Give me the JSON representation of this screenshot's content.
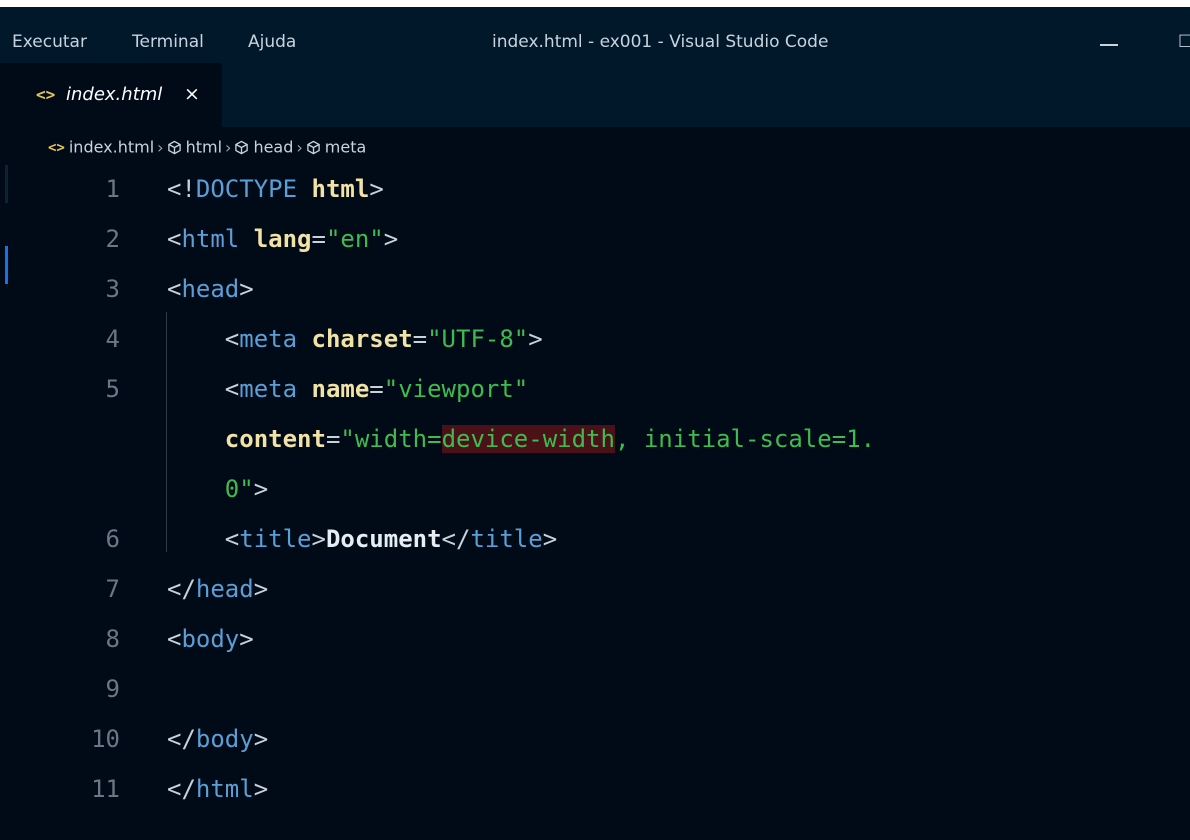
{
  "titlebar": {
    "menu": [
      "Executar",
      "Terminal",
      "Ajuda"
    ],
    "window_title": "index.html - ex001 - Visual Studio Code"
  },
  "tabs": [
    {
      "label": "index.html",
      "close": "×",
      "icon": "html-file-icon"
    }
  ],
  "breadcrumb": [
    "index.html",
    "html",
    "head",
    "meta"
  ],
  "editor": {
    "line_numbers": [
      "1",
      "2",
      "3",
      "4",
      "5",
      "6",
      "7",
      "8",
      "9",
      "10",
      "11"
    ],
    "colors": {
      "tag": "#5a9fd8",
      "attribute": "#f1e2a6",
      "string": "#3fbb4f",
      "punctuation": "#c9d1d9",
      "highlight": "#4a1118"
    },
    "lines": [
      [
        {
          "t": "p",
          "v": "<!"
        },
        {
          "t": "t",
          "v": "DOCTYPE"
        },
        {
          "t": "p",
          "v": " "
        },
        {
          "t": "a",
          "v": "html"
        },
        {
          "t": "p",
          "v": ">"
        }
      ],
      [
        {
          "t": "p",
          "v": "<"
        },
        {
          "t": "t",
          "v": "html"
        },
        {
          "t": "p",
          "v": " "
        },
        {
          "t": "a",
          "v": "lang"
        },
        {
          "t": "p",
          "v": "="
        },
        {
          "t": "s",
          "v": "\"en\""
        },
        {
          "t": "p",
          "v": ">"
        }
      ],
      [
        {
          "t": "p",
          "v": "<"
        },
        {
          "t": "t",
          "v": "head"
        },
        {
          "t": "p",
          "v": ">"
        }
      ],
      [
        {
          "t": "p",
          "v": "    <"
        },
        {
          "t": "t",
          "v": "meta"
        },
        {
          "t": "p",
          "v": " "
        },
        {
          "t": "a",
          "v": "charset"
        },
        {
          "t": "p",
          "v": "="
        },
        {
          "t": "s",
          "v": "\"UTF-8\""
        },
        {
          "t": "p",
          "v": ">"
        }
      ],
      [
        {
          "t": "p",
          "v": "    <"
        },
        {
          "t": "t",
          "v": "meta"
        },
        {
          "t": "p",
          "v": " "
        },
        {
          "t": "a",
          "v": "name"
        },
        {
          "t": "p",
          "v": "="
        },
        {
          "t": "s",
          "v": "\"viewport\""
        }
      ],
      [
        {
          "t": "p",
          "v": "    "
        },
        {
          "t": "a",
          "v": "content"
        },
        {
          "t": "p",
          "v": "="
        },
        {
          "t": "s",
          "v": "\"width="
        },
        {
          "t": "s hl",
          "v": "device-width"
        },
        {
          "t": "s",
          "v": ", initial-scale=1."
        }
      ],
      [
        {
          "t": "p",
          "v": "    "
        },
        {
          "t": "s",
          "v": "0\""
        },
        {
          "t": "p",
          "v": ">"
        }
      ],
      [
        {
          "t": "p",
          "v": "    <"
        },
        {
          "t": "t",
          "v": "title"
        },
        {
          "t": "p",
          "v": ">"
        },
        {
          "t": "x",
          "v": "Document"
        },
        {
          "t": "p",
          "v": "</"
        },
        {
          "t": "t",
          "v": "title"
        },
        {
          "t": "p",
          "v": ">"
        }
      ],
      [
        {
          "t": "p",
          "v": "</"
        },
        {
          "t": "t",
          "v": "head"
        },
        {
          "t": "p",
          "v": ">"
        }
      ],
      [
        {
          "t": "p",
          "v": "<"
        },
        {
          "t": "t",
          "v": "body"
        },
        {
          "t": "p",
          "v": ">"
        }
      ],
      [],
      [
        {
          "t": "p",
          "v": "</"
        },
        {
          "t": "t",
          "v": "body"
        },
        {
          "t": "p",
          "v": ">"
        }
      ],
      [
        {
          "t": "p",
          "v": "</"
        },
        {
          "t": "t",
          "v": "html"
        },
        {
          "t": "p",
          "v": ">"
        }
      ]
    ]
  }
}
